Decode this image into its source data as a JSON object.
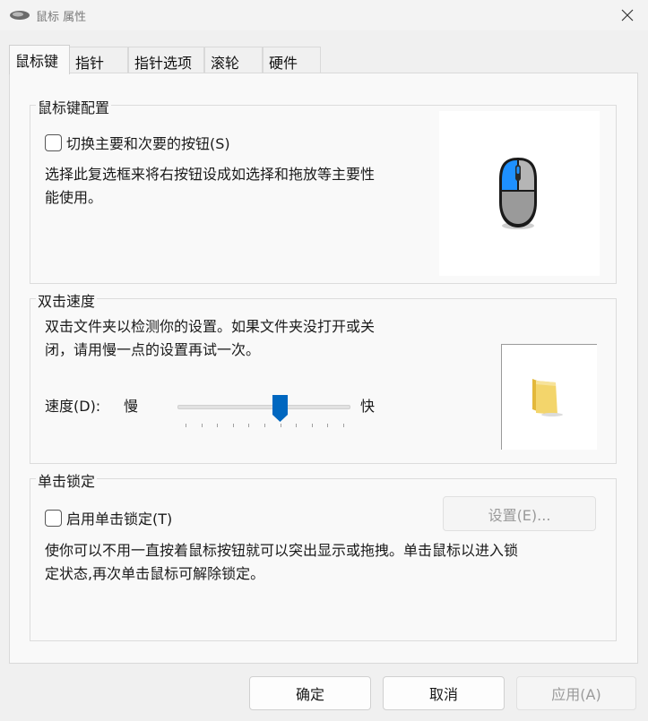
{
  "window": {
    "title": "鼠标 属性"
  },
  "tabs": [
    {
      "label": "鼠标键",
      "active": true
    },
    {
      "label": "指针"
    },
    {
      "label": "指针选项"
    },
    {
      "label": "滚轮"
    },
    {
      "label": "硬件"
    }
  ],
  "button_config": {
    "title": "鼠标键配置",
    "checkbox_label": "切换主要和次要的按钮(S)",
    "checkbox_checked": false,
    "description_line1": "选择此复选框来将右按钮设成如选择和拖放等主要性",
    "description_line2": "能使用。"
  },
  "double_click": {
    "title": "双击速度",
    "description_line1": "双击文件夹以检测你的设置。如果文件夹没打开或关",
    "description_line2": "闭，请用慢一点的设置再试一次。",
    "speed_label": "速度(D):",
    "slow_label": "慢",
    "fast_label": "快",
    "speed_value": 0.6
  },
  "click_lock": {
    "title": "单击锁定",
    "checkbox_label": "启用单击锁定(T)",
    "checkbox_checked": false,
    "settings_button": "设置(E)...",
    "description_line1": "使你可以不用一直按着鼠标按钮就可以突出显示或拖拽。单击鼠标以进入锁",
    "description_line2": "定状态,再次单击鼠标可解除锁定。"
  },
  "footer": {
    "ok": "确定",
    "cancel": "取消",
    "apply": "应用(A)"
  },
  "colors": {
    "accent": "#0067c0",
    "mouse_blue": "#1e90ff",
    "folder": "#f3d56b"
  }
}
